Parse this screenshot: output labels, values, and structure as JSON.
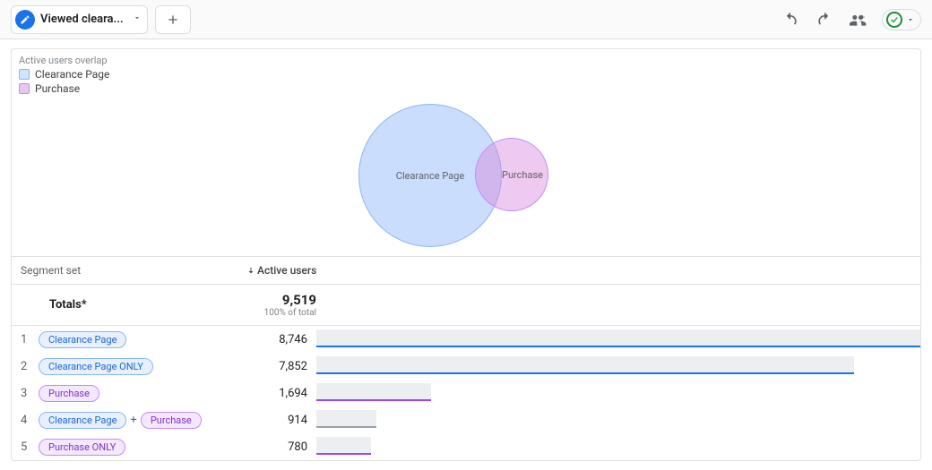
{
  "toolbar": {
    "tab_label": "Viewed cleara..."
  },
  "legend": {
    "title": "Active users overlap",
    "items": [
      {
        "label": "Clearance Page",
        "swatch": "blue"
      },
      {
        "label": "Purchase",
        "swatch": "purple"
      }
    ]
  },
  "venn": {
    "a_label": "Clearance Page",
    "b_label": "Purchase"
  },
  "table": {
    "segment_header": "Segment set",
    "active_header": "Active users",
    "totals_label": "Totals*",
    "totals_value": "9,519",
    "totals_pct": "100% of total",
    "rows": [
      {
        "idx": "1",
        "chips": [
          {
            "text": "Clearance Page",
            "cls": "chip-blue"
          }
        ],
        "value": "8,746",
        "bar_pct": 100,
        "underline": "u-blue"
      },
      {
        "idx": "2",
        "chips": [
          {
            "text": "Clearance Page ONLY",
            "cls": "chip-blue"
          }
        ],
        "value": "7,852",
        "bar_pct": 89,
        "underline": "u-blue"
      },
      {
        "idx": "3",
        "chips": [
          {
            "text": "Purchase",
            "cls": "chip-purple"
          }
        ],
        "value": "1,694",
        "bar_pct": 19,
        "underline": "u-purple"
      },
      {
        "idx": "4",
        "chips": [
          {
            "text": "Clearance Page",
            "cls": "chip-blue"
          },
          {
            "text": "Purchase",
            "cls": "chip-purple"
          }
        ],
        "value": "914",
        "bar_pct": 10,
        "underline": "u-grey"
      },
      {
        "idx": "5",
        "chips": [
          {
            "text": "Purchase ONLY",
            "cls": "chip-purple"
          }
        ],
        "value": "780",
        "bar_pct": 9,
        "underline": "u-purple"
      }
    ]
  },
  "chart_data": {
    "type": "venn",
    "title": "Active users overlap",
    "sets": [
      {
        "name": "Clearance Page",
        "size": 8746,
        "only": 7852,
        "color": "#8ab4f8"
      },
      {
        "name": "Purchase",
        "size": 1694,
        "only": 780,
        "color": "#c58af9"
      }
    ],
    "intersection": {
      "sets": [
        "Clearance Page",
        "Purchase"
      ],
      "size": 914
    },
    "total": 9519
  }
}
